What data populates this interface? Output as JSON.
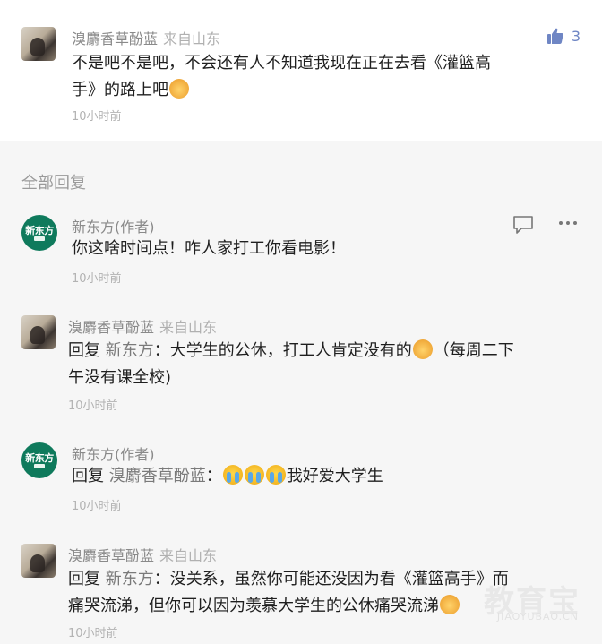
{
  "top_comment": {
    "user": "溴麝香草酚蓝",
    "source": "来自山东",
    "likes": "3",
    "text_line1": "不是吧不是吧，不会还有人不知道我现在正在去看《灌篮高",
    "text_line2": "手》的路上吧",
    "emoji": "cat-emoji",
    "time": "10小时前"
  },
  "section_title": "全部回复",
  "replies": [
    {
      "user": "新东方(作者)",
      "avatar_text": "新东方",
      "text": "你这啥时间点！咋人家打工你看电影！",
      "time": "10小时前"
    },
    {
      "user": "溴麝香草酚蓝",
      "source": "来自山东",
      "reply_prefix": "回复",
      "reply_target": "新东方",
      "text_line1": "：大学生的公休，打工人肯定没有的",
      "text_line1b": "（每周二下",
      "text_line2": "午没有课全校)",
      "time": "10小时前"
    },
    {
      "user": "新东方(作者)",
      "avatar_text": "新东方",
      "reply_prefix": "回复",
      "reply_target": "溴麝香草酚蓝",
      "text_sep": "：",
      "text": "我好爱大学生",
      "time": "10小时前"
    },
    {
      "user": "溴麝香草酚蓝",
      "source": "来自山东",
      "reply_prefix": "回复",
      "reply_target": "新东方",
      "text_line1": "：没关系，虽然你可能还没因为看《灌篮高手》而",
      "text_line2": "痛哭流涕，但你可以因为羡慕大学生的公休痛哭流涕",
      "time": "10小时前"
    }
  ],
  "watermark": {
    "main": "教育宝",
    "sub": "JIAOYUBAO.CN"
  },
  "colors": {
    "logo_green": "#0f7a5c",
    "like_blue": "#6f86c4",
    "muted_text": "#8a8a8a"
  }
}
